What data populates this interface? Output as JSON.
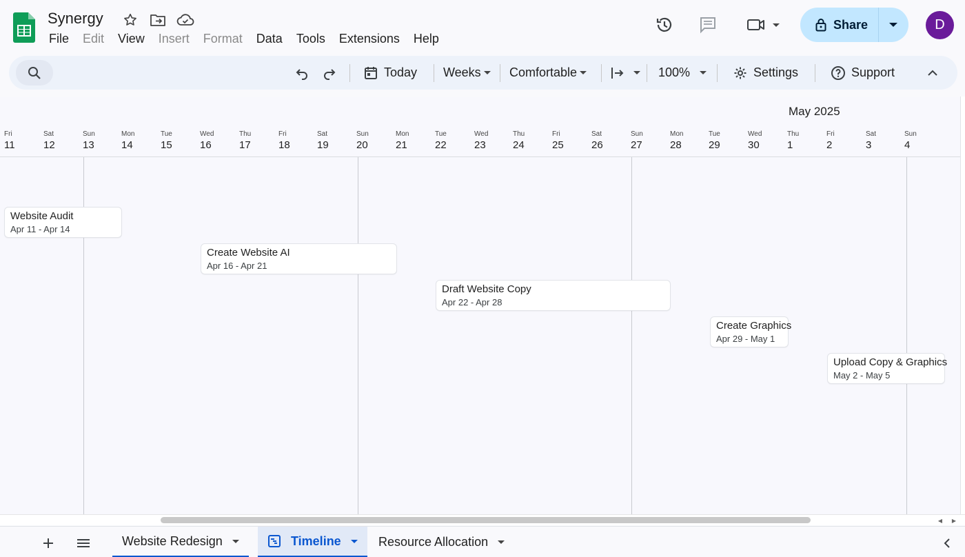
{
  "app": {
    "title": "Synergy",
    "menu": [
      "File",
      "Edit",
      "View",
      "Insert",
      "Format",
      "Data",
      "Tools",
      "Extensions",
      "Help"
    ],
    "disabled_menu": [
      "Edit",
      "Insert",
      "Format"
    ],
    "share_label": "Share",
    "avatar_letter": "D"
  },
  "toolbar": {
    "today": "Today",
    "scale": "Weeks",
    "density": "Comfortable",
    "zoom": "100%",
    "settings": "Settings",
    "support": "Support"
  },
  "timeline": {
    "month": "May 2025",
    "days": [
      {
        "name": "Fri",
        "num": "11"
      },
      {
        "name": "Sat",
        "num": "12"
      },
      {
        "name": "Sun",
        "num": "13"
      },
      {
        "name": "Mon",
        "num": "14"
      },
      {
        "name": "Tue",
        "num": "15"
      },
      {
        "name": "Wed",
        "num": "16"
      },
      {
        "name": "Thu",
        "num": "17"
      },
      {
        "name": "Fri",
        "num": "18"
      },
      {
        "name": "Sat",
        "num": "19"
      },
      {
        "name": "Sun",
        "num": "20"
      },
      {
        "name": "Mon",
        "num": "21"
      },
      {
        "name": "Tue",
        "num": "22"
      },
      {
        "name": "Wed",
        "num": "23"
      },
      {
        "name": "Thu",
        "num": "24"
      },
      {
        "name": "Fri",
        "num": "25"
      },
      {
        "name": "Sat",
        "num": "26"
      },
      {
        "name": "Sun",
        "num": "27"
      },
      {
        "name": "Mon",
        "num": "28"
      },
      {
        "name": "Tue",
        "num": "29"
      },
      {
        "name": "Wed",
        "num": "30"
      },
      {
        "name": "Thu",
        "num": "1"
      },
      {
        "name": "Fri",
        "num": "2"
      },
      {
        "name": "Sat",
        "num": "3"
      },
      {
        "name": "Sun",
        "num": "4"
      }
    ],
    "tasks": [
      {
        "name": "Website Audit",
        "dates": "Apr 11 - Apr 14"
      },
      {
        "name": "Create Website AI",
        "dates": "Apr 16 - Apr 21"
      },
      {
        "name": "Draft Website Copy",
        "dates": "Apr 22 - Apr 28"
      },
      {
        "name": "Create Graphics",
        "dates": "Apr 29 - May 1"
      },
      {
        "name": "Upload Copy & Graphics",
        "dates": "May 2 - May 5"
      }
    ]
  },
  "sheets": {
    "tabs": [
      "Website Redesign",
      "Timeline",
      "Resource Allocation"
    ],
    "active": "Timeline"
  },
  "colors": {
    "accent": "#0b57d0",
    "share_bg": "#c2e7ff",
    "avatar": "#6a1b9a",
    "logo": "#0f9d58"
  }
}
